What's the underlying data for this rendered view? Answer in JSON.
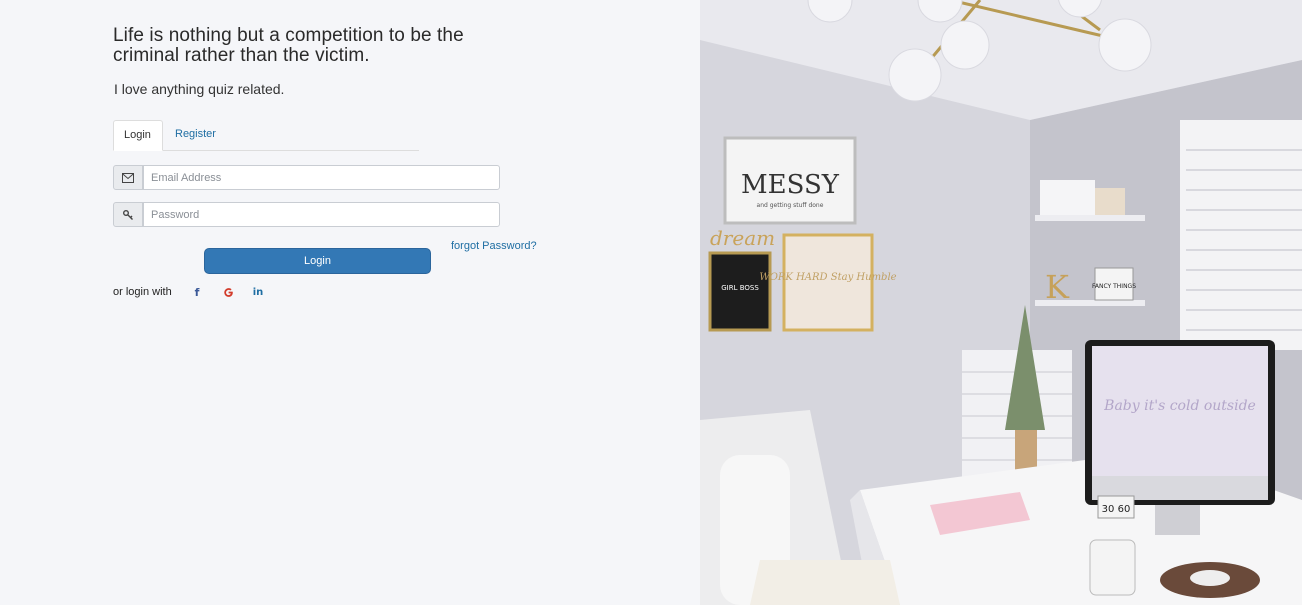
{
  "hero": {
    "headline": "Life is nothing but a competition to be the criminal rather than the victim.",
    "subtitle": "I love anything quiz related."
  },
  "tabs": [
    {
      "label": "Login",
      "active": true
    },
    {
      "label": "Register",
      "active": false
    }
  ],
  "form": {
    "email_placeholder": "Email Address",
    "email_value": "",
    "email_icon": "envelope-icon",
    "password_placeholder": "Password",
    "password_value": "",
    "password_icon": "key-icon",
    "forgot_label": "forgot Password?",
    "submit_label": "Login"
  },
  "social": {
    "label": "or login with",
    "providers": [
      {
        "name": "facebook",
        "glyph": "f",
        "color": "#3b5998"
      },
      {
        "name": "google",
        "glyph": "G",
        "color": "#d23b2b"
      },
      {
        "name": "linkedin",
        "glyph": "in",
        "color": "#1f6ea3"
      }
    ]
  },
  "photo": {
    "frame_text": "MESSY",
    "frame_subtext": "and getting stuff done",
    "script_word": "dream",
    "board_text": "GIRL BOSS",
    "print_text": "WORK HARD Stay Humble",
    "sign_text": "FANCY THINGS",
    "letter": "K",
    "screen_text": "Baby it's cold outside",
    "calendar_text": "30 60"
  },
  "colors": {
    "accent": "#3378b5",
    "link": "#1f6ea3",
    "background": "#f5f6f9"
  }
}
